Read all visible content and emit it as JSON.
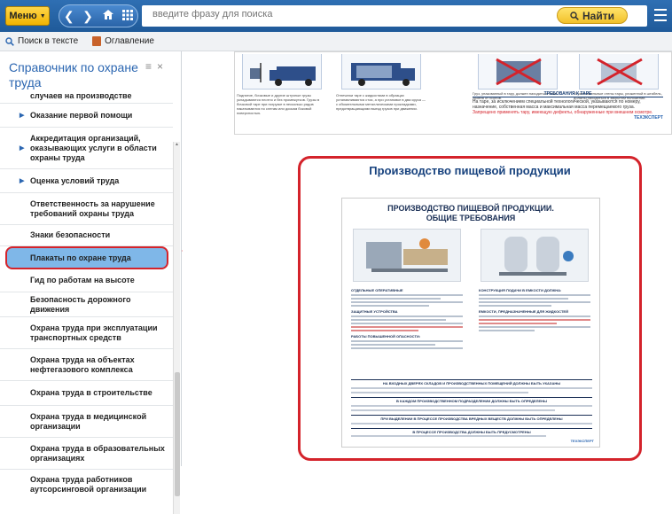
{
  "topbar": {
    "menu_label": "Меню",
    "search_placeholder": "введите фразу для поиска",
    "find_label": "Найти"
  },
  "subbar": {
    "search_in_text": "Поиск в тексте",
    "contents": "Оглавление"
  },
  "sidebar": {
    "title": "Справочник по охране труда",
    "items": [
      {
        "label": "случаев на производстве",
        "expandable": false
      },
      {
        "label": "Оказание первой помощи",
        "expandable": true
      },
      {
        "label": "Аккредитация организаций, оказывающих услуги в области охраны труда",
        "expandable": true
      },
      {
        "label": "Оценка условий труда",
        "expandable": true
      },
      {
        "label": "Ответственность за нарушение требований охраны труда",
        "expandable": false
      },
      {
        "label": "Знаки безопасности",
        "expandable": false
      },
      {
        "label": "Плакаты по охране труда",
        "expandable": false,
        "active": true
      },
      {
        "label": "Гид по работам на высоте",
        "expandable": false
      },
      {
        "label": "Безопасность дорожного движения",
        "expandable": false
      },
      {
        "label": "Охрана труда при эксплуатации транспортных средств",
        "expandable": false
      },
      {
        "label": "Охрана труда на объектах нефтегазового комплекса",
        "expandable": false
      },
      {
        "label": "Охрана труда в строительстве",
        "expandable": false
      },
      {
        "label": "Охрана труда в медицинской организации",
        "expandable": false
      },
      {
        "label": "Охрана труда в образовательных организациях",
        "expandable": false
      },
      {
        "label": "Охрана труда работников аутсорсинговой организации",
        "expandable": false
      }
    ]
  },
  "content": {
    "prev_poster": {
      "captions": [
        "Поднятие, бочковые и другие штучные грузы укладываются плотно и без промежутков. Грузы в бочковой таре при погрузке в несколько рядов накатываются по слегам или доскам боковой поверхностью.",
        "Отпечатки таре с жидкостями в образцах устанавливаются стоя, а при установке в два яруса — с обязательными металлическими прокладками, предотвращающими выезд грузов при движении.",
        "Груз, упакованный в тару, должен находиться ниже уровня от бортов.",
        "Ограничительные стены тары, уложенной в штабель, должны находиться в закрытом положении."
      ],
      "tare_title": "ТРЕБОВАНИЯ К ТАРЕ",
      "tare_text": "На таре, за исключением специальной технологической, указываются по номеру, назначение, собственная масса и максимальная масса перемещаемого груза.",
      "tare_warning": "Запрещено применять тару, имеющую дефекты, обнаруженные при внешнем осмотре.",
      "logo": "ТЕХЭКСПЕРТ"
    },
    "poster_card": {
      "title": "Производство пищевой продукции",
      "poster_heading_1": "ПРОИЗВОДСТВО ПИЩЕВОЙ ПРОДУКЦИИ.",
      "poster_heading_2": "ОБЩИЕ ТРЕБОВАНИЯ",
      "left_sections": [
        "ОТДЕЛЬНЫЕ ОПЕРАТИВНЫЕ",
        "ЗАЩИТНЫЕ УСТРОЙСТВА",
        "РАБОТЫ ПОВЫШЕННОЙ ОПАСНОСТИ:"
      ],
      "right_sections": [
        "КОНСТРУКЦИЯ ПОДАЧИ В ЕМКОСТИ ДОЛЖНА:",
        "ЕМКОСТИ, ПРЕДНАЗНАЧЕННЫЕ ДЛЯ ЖИДКОСТЕЙ"
      ],
      "bands": [
        "НА ВХОДНЫХ ДВЕРЯХ СКЛАДОВ И ПРОИЗВОДСТВЕННЫХ ПОМЕЩЕНИЙ ДОЛЖНЫ БЫТЬ УКАЗАНЫ",
        "В КАЖДОМ ПРОИЗВОДСТВЕННОМ ПОДРАЗДЕЛЕНИИ ДОЛЖНЫ БЫТЬ ОПРЕДЕЛЕНЫ",
        "ПРИ ВЫДЕЛЕНИИ В ПРОЦЕССЕ ПРОИЗВОДСТВА ВРЕДНЫХ ВЕЩЕСТВ ДОЛЖНЫ БЫТЬ ОПРЕДЕЛЕНЫ",
        "В ПРОЦЕССЕ ПРОИЗВОДСТВА ДОЛЖНЫ БЫТЬ ПРЕДУСМОТРЕНЫ"
      ],
      "logo": "ТЕХЭКСПЕРТ"
    }
  }
}
